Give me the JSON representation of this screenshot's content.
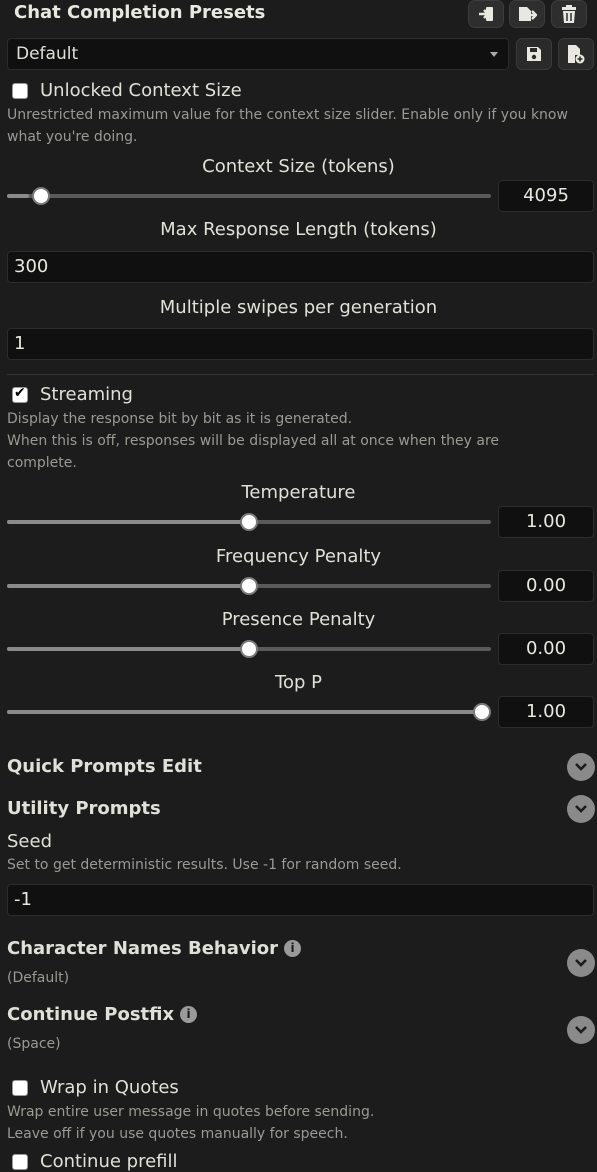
{
  "header": {
    "title": "Chat Completion Presets"
  },
  "preset": {
    "selected": "Default"
  },
  "unlocked_context": {
    "label": "Unlocked Context Size",
    "checked": false,
    "hint": "Unrestricted maximum value for the context size slider. Enable only if you know what you're doing."
  },
  "context_size": {
    "label": "Context Size (tokens)",
    "value": "4095",
    "fraction": 0.045
  },
  "max_response": {
    "label": "Max Response Length (tokens)",
    "value": "300"
  },
  "swipes": {
    "label": "Multiple swipes per generation",
    "value": "1"
  },
  "streaming": {
    "label": "Streaming",
    "checked": true,
    "hint1": "Display the response bit by bit as it is generated.",
    "hint2": "When this is off, responses will be displayed all at once when they are complete."
  },
  "sliders": [
    {
      "label": "Temperature",
      "value": "1.00",
      "fraction": 0.5
    },
    {
      "label": "Frequency Penalty",
      "value": "0.00",
      "fraction": 0.5
    },
    {
      "label": "Presence Penalty",
      "value": "0.00",
      "fraction": 0.5
    },
    {
      "label": "Top P",
      "value": "1.00",
      "fraction": 1.0
    }
  ],
  "sections": {
    "quick_prompts": "Quick Prompts Edit",
    "utility_prompts": "Utility Prompts"
  },
  "seed": {
    "label": "Seed",
    "hint": "Set to get deterministic results. Use -1 for random seed.",
    "value": "-1"
  },
  "char_names": {
    "label": "Character Names Behavior",
    "value": "(Default)"
  },
  "continue_postfix": {
    "label": "Continue Postfix",
    "value": "(Space)"
  },
  "wrap_quotes": {
    "label": "Wrap in Quotes",
    "checked": false,
    "hint1": "Wrap entire user message in quotes before sending.",
    "hint2": "Leave off if you use quotes manually for speech."
  },
  "continue_prefill": {
    "label": "Continue prefill",
    "checked": false
  }
}
